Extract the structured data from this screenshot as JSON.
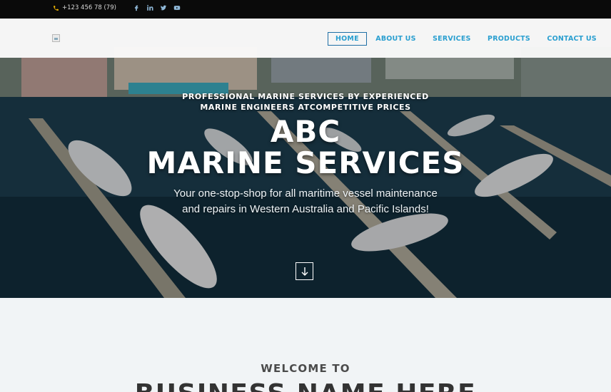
{
  "topbar": {
    "phone": "+123 456 78 (79)",
    "social": [
      {
        "icon": "facebook-icon"
      },
      {
        "icon": "linkedin-icon"
      },
      {
        "icon": "twitter-icon"
      },
      {
        "icon": "youtube-icon"
      }
    ]
  },
  "nav": {
    "items": [
      {
        "label": "HOME",
        "active": true
      },
      {
        "label": "ABOUT US",
        "active": false
      },
      {
        "label": "SERVICES",
        "active": false
      },
      {
        "label": "PRODUCTS",
        "active": false
      },
      {
        "label": "CONTACT US",
        "active": false
      }
    ]
  },
  "hero": {
    "tagline_line1": "PROFESSIONAL MARINE SERVICES BY EXPERIENCED",
    "tagline_line2": "MARINE ENGINEERS ATCOMPETITIVE PRICES",
    "title_line1": "ABC",
    "title_line2": "MARINE SERVICES",
    "subtitle_line1": "Your one-stop-shop for all maritime vessel maintenance",
    "subtitle_line2": "and repairs in Western Australia and Pacific Islands!",
    "scroll_icon": "arrow-down-icon"
  },
  "section": {
    "welcome": "WELCOME TO",
    "business_name": "BUSINESS NAME HERE"
  },
  "colors": {
    "accent": "#2a9fd0",
    "active_border": "#1f6fa5",
    "topbar_bg": "#0a0a0a",
    "page_bg": "#f1f4f6"
  }
}
